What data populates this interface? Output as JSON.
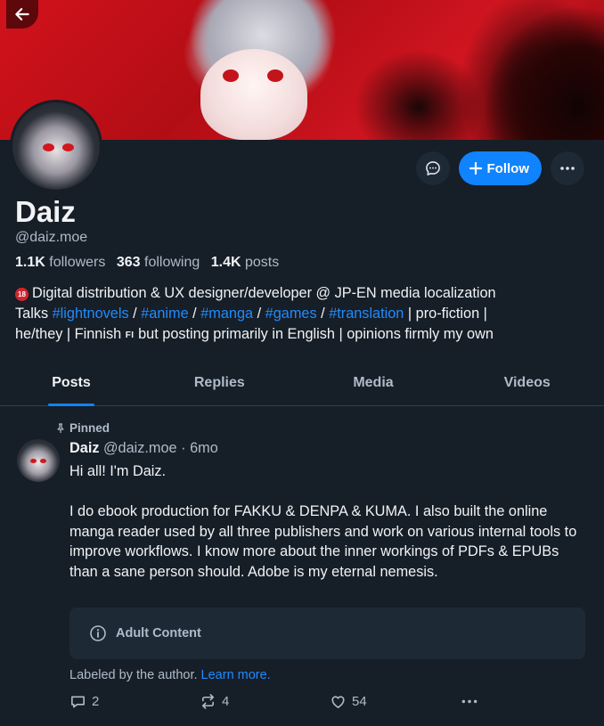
{
  "header": {
    "back_icon": "arrow-left-icon"
  },
  "profile": {
    "display_name": "Daiz",
    "handle": "@daiz.moe",
    "stats": {
      "followers_count": "1.1K",
      "followers_label": "followers",
      "following_count": "363",
      "following_label": "following",
      "posts_count": "1.4K",
      "posts_label": "posts"
    },
    "bio": {
      "line1_badge": "18",
      "line1": "Digital distribution & UX designer/developer @ JP-EN media localization",
      "line2_prefix": "Talks",
      "tags": [
        "#lightnovels",
        "#anime",
        "#manga",
        "#games",
        "#translation"
      ],
      "sep": "/",
      "line2_suffix": "| pro-fiction |",
      "line3_a": "he/they | Finnish",
      "line3_flag": "FI",
      "line3_b": "but posting primarily in English | opinions firmly my own"
    }
  },
  "actions": {
    "follow_label": "Follow",
    "message_icon": "chat-bubble-icon",
    "more_icon": "ellipsis-icon"
  },
  "tabs": [
    {
      "label": "Posts",
      "active": true
    },
    {
      "label": "Replies",
      "active": false
    },
    {
      "label": "Media",
      "active": false
    },
    {
      "label": "Videos",
      "active": false
    }
  ],
  "post": {
    "pinned_label": "Pinned",
    "author": "Daiz",
    "handle": "@daiz.moe",
    "dot": "·",
    "time": "6mo",
    "text": "Hi all! I'm Daiz.\n\nI do ebook production for FAKKU & DENPA & KUMA. I also built the online manga reader used by all three publishers and work on various internal tools to improve workflows. I know more about the inner workings of PDFs & EPUBs than a sane person should. Adobe is my eternal nemesis.",
    "content_warning": "Adult Content",
    "labeled_text": "Labeled by the author.",
    "learn_more": "Learn more.",
    "replies": "2",
    "reposts": "4",
    "likes": "54"
  },
  "colors": {
    "background": "#161e27",
    "accent": "#1083fe",
    "link": "#208bfe",
    "muted": "#aebbc9"
  }
}
